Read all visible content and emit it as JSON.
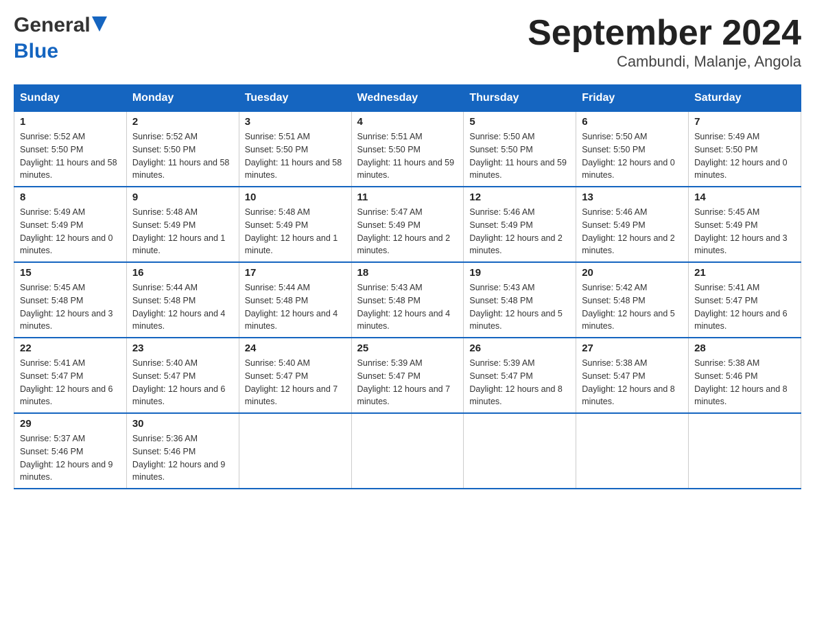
{
  "header": {
    "logo_general": "General",
    "logo_blue": "Blue",
    "title": "September 2024",
    "subtitle": "Cambundi, Malanje, Angola"
  },
  "days_of_week": [
    "Sunday",
    "Monday",
    "Tuesday",
    "Wednesday",
    "Thursday",
    "Friday",
    "Saturday"
  ],
  "weeks": [
    [
      {
        "day": "1",
        "sunrise": "Sunrise: 5:52 AM",
        "sunset": "Sunset: 5:50 PM",
        "daylight": "Daylight: 11 hours and 58 minutes."
      },
      {
        "day": "2",
        "sunrise": "Sunrise: 5:52 AM",
        "sunset": "Sunset: 5:50 PM",
        "daylight": "Daylight: 11 hours and 58 minutes."
      },
      {
        "day": "3",
        "sunrise": "Sunrise: 5:51 AM",
        "sunset": "Sunset: 5:50 PM",
        "daylight": "Daylight: 11 hours and 58 minutes."
      },
      {
        "day": "4",
        "sunrise": "Sunrise: 5:51 AM",
        "sunset": "Sunset: 5:50 PM",
        "daylight": "Daylight: 11 hours and 59 minutes."
      },
      {
        "day": "5",
        "sunrise": "Sunrise: 5:50 AM",
        "sunset": "Sunset: 5:50 PM",
        "daylight": "Daylight: 11 hours and 59 minutes."
      },
      {
        "day": "6",
        "sunrise": "Sunrise: 5:50 AM",
        "sunset": "Sunset: 5:50 PM",
        "daylight": "Daylight: 12 hours and 0 minutes."
      },
      {
        "day": "7",
        "sunrise": "Sunrise: 5:49 AM",
        "sunset": "Sunset: 5:50 PM",
        "daylight": "Daylight: 12 hours and 0 minutes."
      }
    ],
    [
      {
        "day": "8",
        "sunrise": "Sunrise: 5:49 AM",
        "sunset": "Sunset: 5:49 PM",
        "daylight": "Daylight: 12 hours and 0 minutes."
      },
      {
        "day": "9",
        "sunrise": "Sunrise: 5:48 AM",
        "sunset": "Sunset: 5:49 PM",
        "daylight": "Daylight: 12 hours and 1 minute."
      },
      {
        "day": "10",
        "sunrise": "Sunrise: 5:48 AM",
        "sunset": "Sunset: 5:49 PM",
        "daylight": "Daylight: 12 hours and 1 minute."
      },
      {
        "day": "11",
        "sunrise": "Sunrise: 5:47 AM",
        "sunset": "Sunset: 5:49 PM",
        "daylight": "Daylight: 12 hours and 2 minutes."
      },
      {
        "day": "12",
        "sunrise": "Sunrise: 5:46 AM",
        "sunset": "Sunset: 5:49 PM",
        "daylight": "Daylight: 12 hours and 2 minutes."
      },
      {
        "day": "13",
        "sunrise": "Sunrise: 5:46 AM",
        "sunset": "Sunset: 5:49 PM",
        "daylight": "Daylight: 12 hours and 2 minutes."
      },
      {
        "day": "14",
        "sunrise": "Sunrise: 5:45 AM",
        "sunset": "Sunset: 5:49 PM",
        "daylight": "Daylight: 12 hours and 3 minutes."
      }
    ],
    [
      {
        "day": "15",
        "sunrise": "Sunrise: 5:45 AM",
        "sunset": "Sunset: 5:48 PM",
        "daylight": "Daylight: 12 hours and 3 minutes."
      },
      {
        "day": "16",
        "sunrise": "Sunrise: 5:44 AM",
        "sunset": "Sunset: 5:48 PM",
        "daylight": "Daylight: 12 hours and 4 minutes."
      },
      {
        "day": "17",
        "sunrise": "Sunrise: 5:44 AM",
        "sunset": "Sunset: 5:48 PM",
        "daylight": "Daylight: 12 hours and 4 minutes."
      },
      {
        "day": "18",
        "sunrise": "Sunrise: 5:43 AM",
        "sunset": "Sunset: 5:48 PM",
        "daylight": "Daylight: 12 hours and 4 minutes."
      },
      {
        "day": "19",
        "sunrise": "Sunrise: 5:43 AM",
        "sunset": "Sunset: 5:48 PM",
        "daylight": "Daylight: 12 hours and 5 minutes."
      },
      {
        "day": "20",
        "sunrise": "Sunrise: 5:42 AM",
        "sunset": "Sunset: 5:48 PM",
        "daylight": "Daylight: 12 hours and 5 minutes."
      },
      {
        "day": "21",
        "sunrise": "Sunrise: 5:41 AM",
        "sunset": "Sunset: 5:47 PM",
        "daylight": "Daylight: 12 hours and 6 minutes."
      }
    ],
    [
      {
        "day": "22",
        "sunrise": "Sunrise: 5:41 AM",
        "sunset": "Sunset: 5:47 PM",
        "daylight": "Daylight: 12 hours and 6 minutes."
      },
      {
        "day": "23",
        "sunrise": "Sunrise: 5:40 AM",
        "sunset": "Sunset: 5:47 PM",
        "daylight": "Daylight: 12 hours and 6 minutes."
      },
      {
        "day": "24",
        "sunrise": "Sunrise: 5:40 AM",
        "sunset": "Sunset: 5:47 PM",
        "daylight": "Daylight: 12 hours and 7 minutes."
      },
      {
        "day": "25",
        "sunrise": "Sunrise: 5:39 AM",
        "sunset": "Sunset: 5:47 PM",
        "daylight": "Daylight: 12 hours and 7 minutes."
      },
      {
        "day": "26",
        "sunrise": "Sunrise: 5:39 AM",
        "sunset": "Sunset: 5:47 PM",
        "daylight": "Daylight: 12 hours and 8 minutes."
      },
      {
        "day": "27",
        "sunrise": "Sunrise: 5:38 AM",
        "sunset": "Sunset: 5:47 PM",
        "daylight": "Daylight: 12 hours and 8 minutes."
      },
      {
        "day": "28",
        "sunrise": "Sunrise: 5:38 AM",
        "sunset": "Sunset: 5:46 PM",
        "daylight": "Daylight: 12 hours and 8 minutes."
      }
    ],
    [
      {
        "day": "29",
        "sunrise": "Sunrise: 5:37 AM",
        "sunset": "Sunset: 5:46 PM",
        "daylight": "Daylight: 12 hours and 9 minutes."
      },
      {
        "day": "30",
        "sunrise": "Sunrise: 5:36 AM",
        "sunset": "Sunset: 5:46 PM",
        "daylight": "Daylight: 12 hours and 9 minutes."
      },
      null,
      null,
      null,
      null,
      null
    ]
  ]
}
